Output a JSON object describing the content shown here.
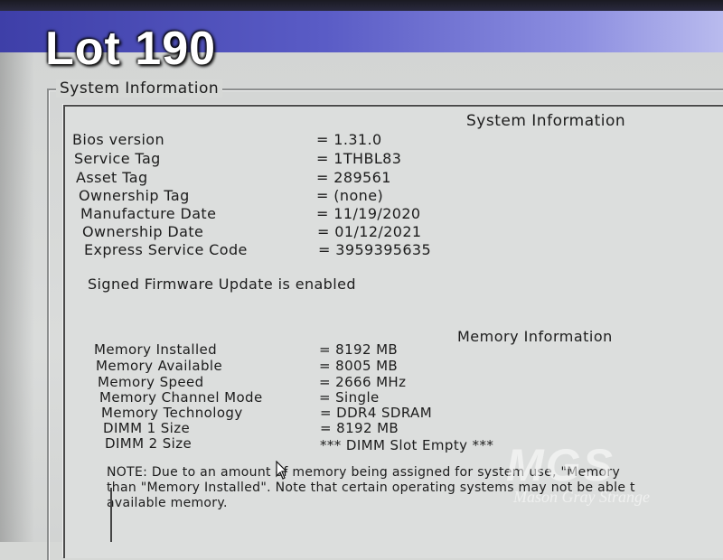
{
  "overlay": {
    "lot_label": "Lot 190"
  },
  "group": {
    "legend": "System Information"
  },
  "system": {
    "heading": "System Information",
    "rows": [
      {
        "label": "Bios version",
        "value": "= 1.31.0"
      },
      {
        "label": "Service Tag",
        "value": "= 1THBL83"
      },
      {
        "label": "Asset Tag",
        "value": "= 289561"
      },
      {
        "label": "Ownership Tag",
        "value": "= (none)"
      },
      {
        "label": "Manufacture Date",
        "value": "= 11/19/2020"
      },
      {
        "label": "Ownership Date",
        "value": "= 01/12/2021"
      },
      {
        "label": "Express Service Code",
        "value": "= 3959395635"
      }
    ],
    "firmware_status": "Signed Firmware Update is enabled"
  },
  "memory": {
    "heading": "Memory Information",
    "rows": [
      {
        "label": "Memory Installed",
        "value": "= 8192 MB"
      },
      {
        "label": "Memory Available",
        "value": "= 8005 MB"
      },
      {
        "label": "Memory Speed",
        "value": "= 2666 MHz"
      },
      {
        "label": "Memory Channel Mode",
        "value": "= Single"
      },
      {
        "label": "Memory Technology",
        "value": "= DDR4 SDRAM"
      },
      {
        "label": "DIMM 1 Size",
        "value": "= 8192 MB"
      },
      {
        "label": "DIMM 2 Size",
        "value": "*** DIMM Slot Empty ***"
      }
    ],
    "note_lines": [
      "NOTE: Due to an amount of memory being assigned for system use, \"Memory",
      "than \"Memory Installed\". Note that certain operating systems may not be able t",
      "available memory."
    ]
  },
  "watermark": {
    "logo": "MGS",
    "subtitle": "Mason Gray Strange"
  },
  "colors": {
    "title_bar": "#3e3fa8",
    "background": "#d6d8d6",
    "text": "#1c1c1c"
  }
}
